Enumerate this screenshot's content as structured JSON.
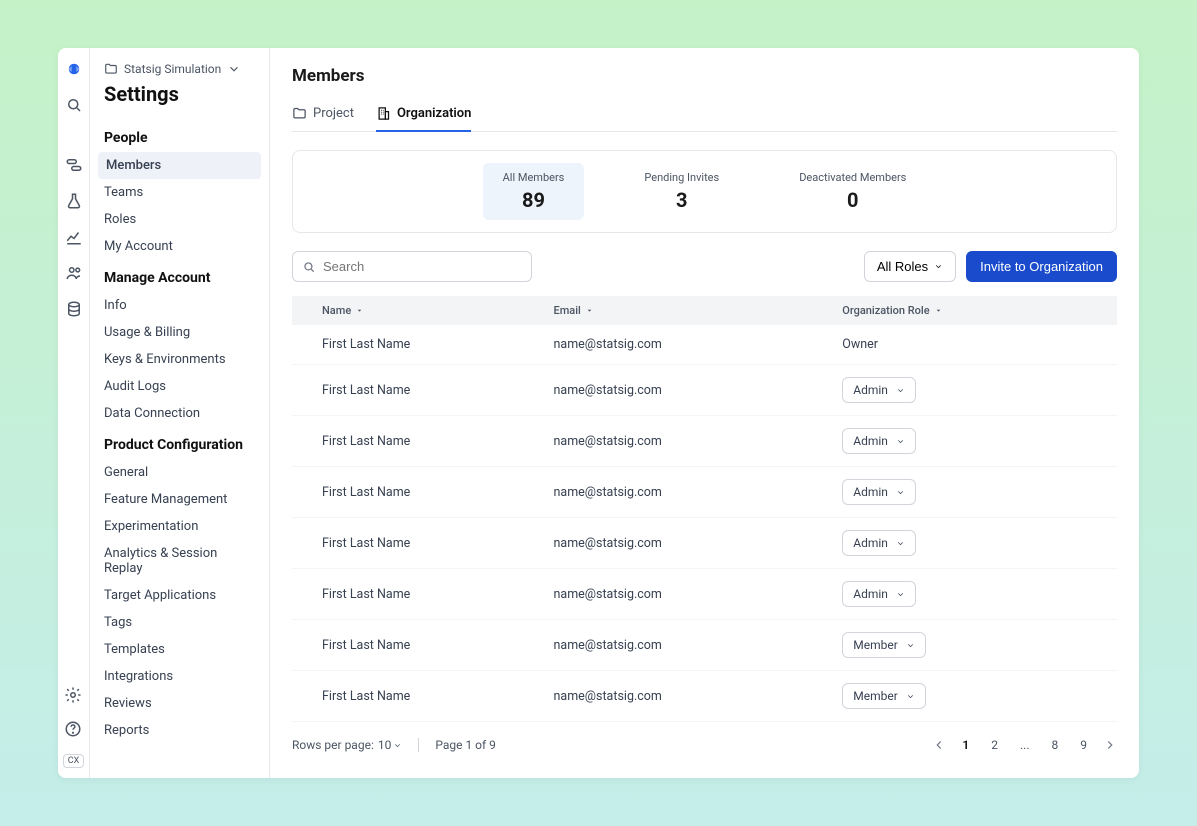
{
  "breadcrumb": {
    "project": "Statsig Simulation"
  },
  "page_title": "Settings",
  "sidebar": {
    "sections": [
      {
        "title": "People",
        "items": [
          "Members",
          "Teams",
          "Roles",
          "My Account"
        ],
        "active_index": 0
      },
      {
        "title": "Manage Account",
        "items": [
          "Info",
          "Usage & Billing",
          "Keys & Environments",
          "Audit Logs",
          "Data Connection"
        ]
      },
      {
        "title": "Product Configuration",
        "items": [
          "General",
          "Feature Management",
          "Experimentation",
          "Analytics & Session Replay",
          "Target Applications",
          "Tags",
          "Templates",
          "Integrations",
          "Reviews",
          "Reports"
        ]
      }
    ]
  },
  "main": {
    "title": "Members",
    "tabs": {
      "project": "Project",
      "organization": "Organization"
    },
    "stats": {
      "all_members": {
        "label": "All Members",
        "value": "89"
      },
      "pending": {
        "label": "Pending Invites",
        "value": "3"
      },
      "deactivated": {
        "label": "Deactivated Members",
        "value": "0"
      }
    },
    "search_placeholder": "Search",
    "roles_filter": "All Roles",
    "invite_button": "Invite to Organization",
    "columns": {
      "name": "Name",
      "email": "Email",
      "role": "Organization Role"
    },
    "rows": [
      {
        "name": "First Last Name",
        "email": "name@statsig.com",
        "role": "Owner",
        "role_editable": false
      },
      {
        "name": "First Last Name",
        "email": "name@statsig.com",
        "role": "Admin",
        "role_editable": true
      },
      {
        "name": "First Last Name",
        "email": "name@statsig.com",
        "role": "Admin",
        "role_editable": true
      },
      {
        "name": "First Last Name",
        "email": "name@statsig.com",
        "role": "Admin",
        "role_editable": true
      },
      {
        "name": "First Last Name",
        "email": "name@statsig.com",
        "role": "Admin",
        "role_editable": true
      },
      {
        "name": "First Last Name",
        "email": "name@statsig.com",
        "role": "Admin",
        "role_editable": true
      },
      {
        "name": "First Last Name",
        "email": "name@statsig.com",
        "role": "Member",
        "role_editable": true
      },
      {
        "name": "First Last Name",
        "email": "name@statsig.com",
        "role": "Member",
        "role_editable": true
      }
    ],
    "footer": {
      "rows_label": "Rows per page:",
      "rows_value": "10",
      "page_info": "Page 1 of 9",
      "pages": [
        "1",
        "2",
        "...",
        "8",
        "9"
      ]
    }
  },
  "rail_bottom_badge": "CX"
}
